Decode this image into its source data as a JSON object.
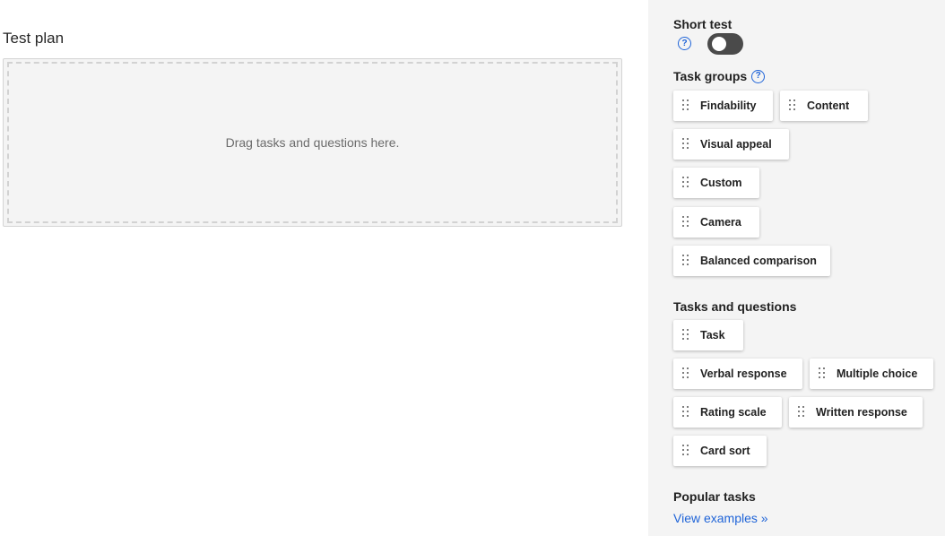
{
  "main": {
    "title": "Test plan",
    "dropzone_text": "Drag tasks and questions here."
  },
  "sidebar": {
    "short_test": {
      "label": "Short test",
      "help": "?",
      "toggle_on": false
    },
    "task_groups": {
      "label": "Task groups",
      "help": "?",
      "items": [
        "Findability",
        "Content",
        "Visual appeal",
        "Custom",
        "Camera",
        "Balanced comparison"
      ]
    },
    "tasks_and_questions": {
      "label": "Tasks and questions",
      "items": [
        "Task",
        "Verbal response",
        "Multiple choice",
        "Rating scale",
        "Written response",
        "Card sort"
      ]
    },
    "popular_tasks": {
      "label": "Popular tasks",
      "link": "View examples »"
    }
  },
  "colors": {
    "accent": "#1f64d8",
    "toggle_off": "#4a4a4a",
    "sidebar_bg": "#f4f4f4"
  }
}
